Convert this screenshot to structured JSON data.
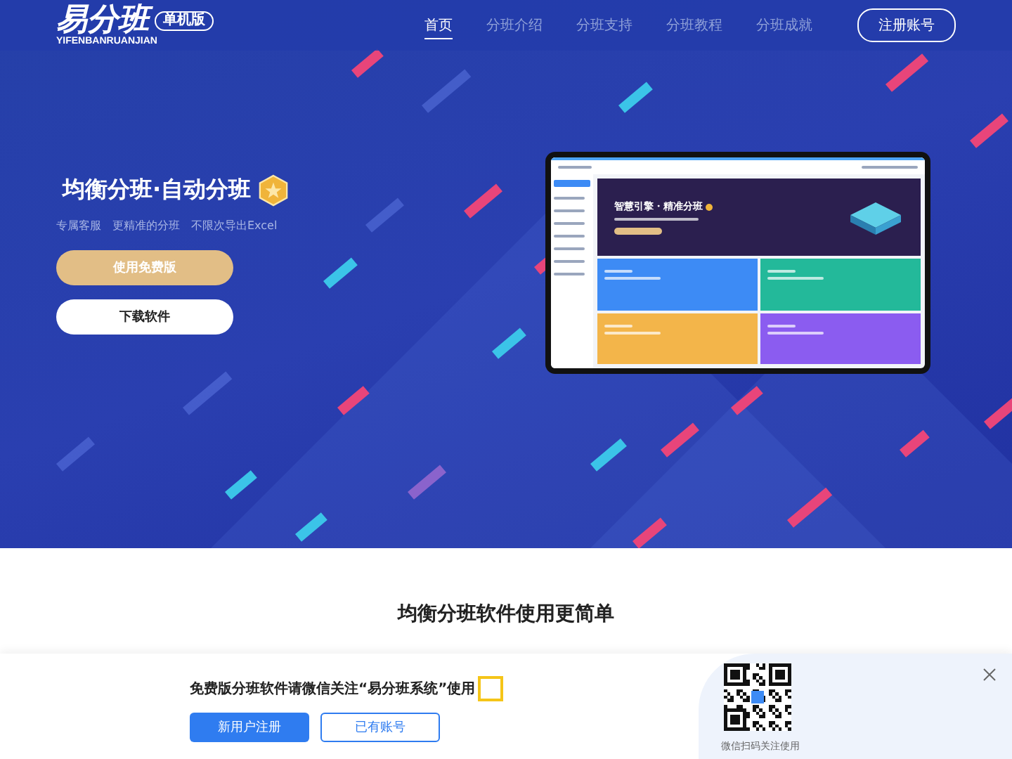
{
  "header": {
    "logo": "易分班",
    "edition_badge": "单机版",
    "logo_subtitle": "YIFENBANRUANJIAN",
    "nav": [
      {
        "label": "首页",
        "selected": true
      },
      {
        "label": "分班介绍",
        "selected": false
      },
      {
        "label": "分班支持",
        "selected": false
      },
      {
        "label": "分班教程",
        "selected": false
      },
      {
        "label": "分班成就",
        "selected": false
      }
    ],
    "register_button": "注册账号"
  },
  "hero": {
    "title": "均衡分班·自动分班",
    "features": [
      "专属客服",
      "更精准的分班",
      "不限次导出Excel"
    ],
    "primary_button": "使用免费版",
    "secondary_button": "下载软件",
    "preview": {
      "banner_title": "智慧引擎・精准分班",
      "tiles": [
        {
          "color": "#3d8bf5"
        },
        {
          "color": "#23b99a"
        },
        {
          "color": "#f3b54a"
        },
        {
          "color": "#8b5cf0"
        }
      ]
    }
  },
  "section": {
    "heading": "均衡分班软件使用更简单"
  },
  "popup": {
    "message": "免费版分班软件请微信关注“易分班系统”使用",
    "register_button": "新用户注册",
    "login_button": "已有账号",
    "qr_caption": "微信扫码关注使用"
  }
}
